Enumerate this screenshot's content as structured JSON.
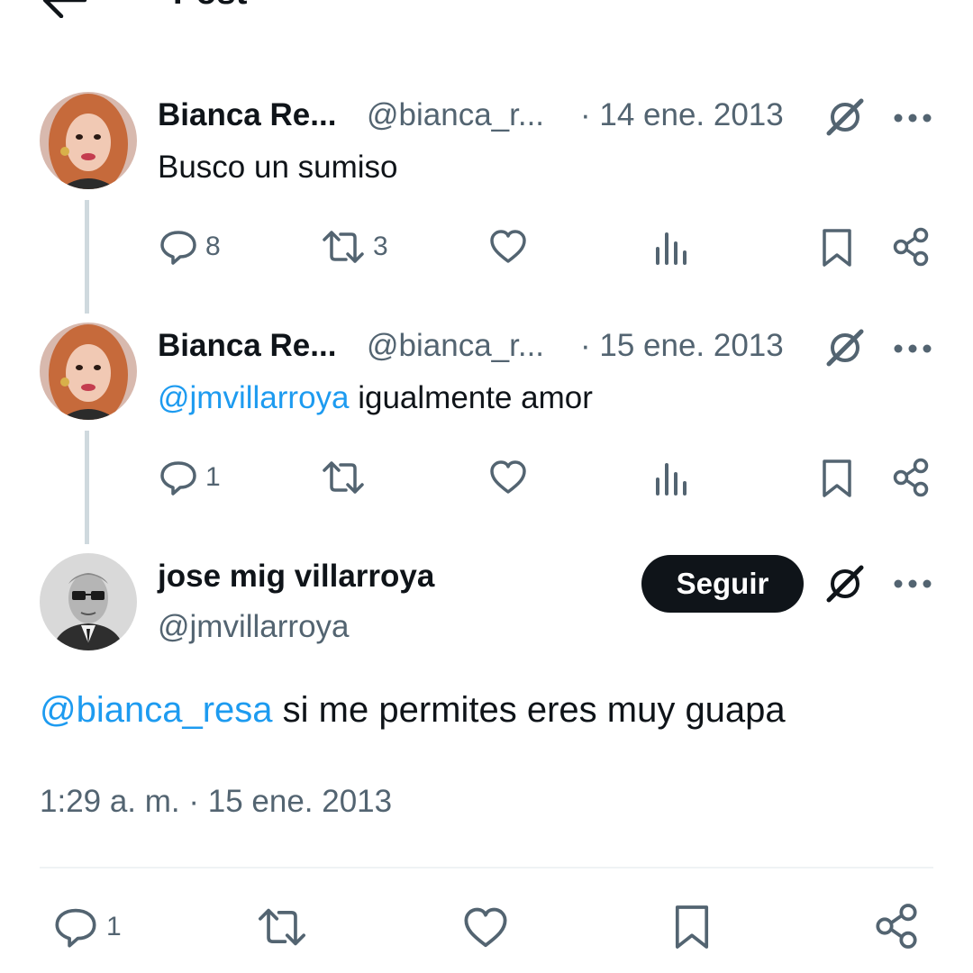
{
  "header": {
    "title": "Post",
    "back_icon": "arrow-left-icon"
  },
  "tweets": [
    {
      "name": "Bianca Re...",
      "handle": "@bianca_r...",
      "date": "· 14 ene. 2013",
      "text": "Busco un sumiso",
      "mention": "",
      "stats": {
        "replies": "8",
        "retweets": "3"
      }
    },
    {
      "name": "Bianca Re...",
      "handle": "@bianca_r...",
      "date": "· 15 ene. 2013",
      "mention": "@jmvillarroya",
      "text": " igualmente amor",
      "stats": {
        "replies": "1",
        "retweets": ""
      }
    }
  ],
  "main_tweet": {
    "name": "jose mig villarroya",
    "handle": "@jmvillarroya",
    "follow_label": "Seguir",
    "mention": "@bianca_resa",
    "text": " si me permites eres muy guapa",
    "timestamp": "1:29 a. m. · 15 ene. 2013",
    "stats": {
      "replies": "1"
    }
  },
  "colors": {
    "accent": "#1d9bf0",
    "text": "#0f1419",
    "secondary": "#536471",
    "button": "#0f1419"
  },
  "icons": [
    "arrow-left-icon",
    "reply-icon",
    "retweet-icon",
    "like-icon",
    "views-icon",
    "bookmark-icon",
    "share-icon",
    "grok-icon",
    "more-icon"
  ]
}
